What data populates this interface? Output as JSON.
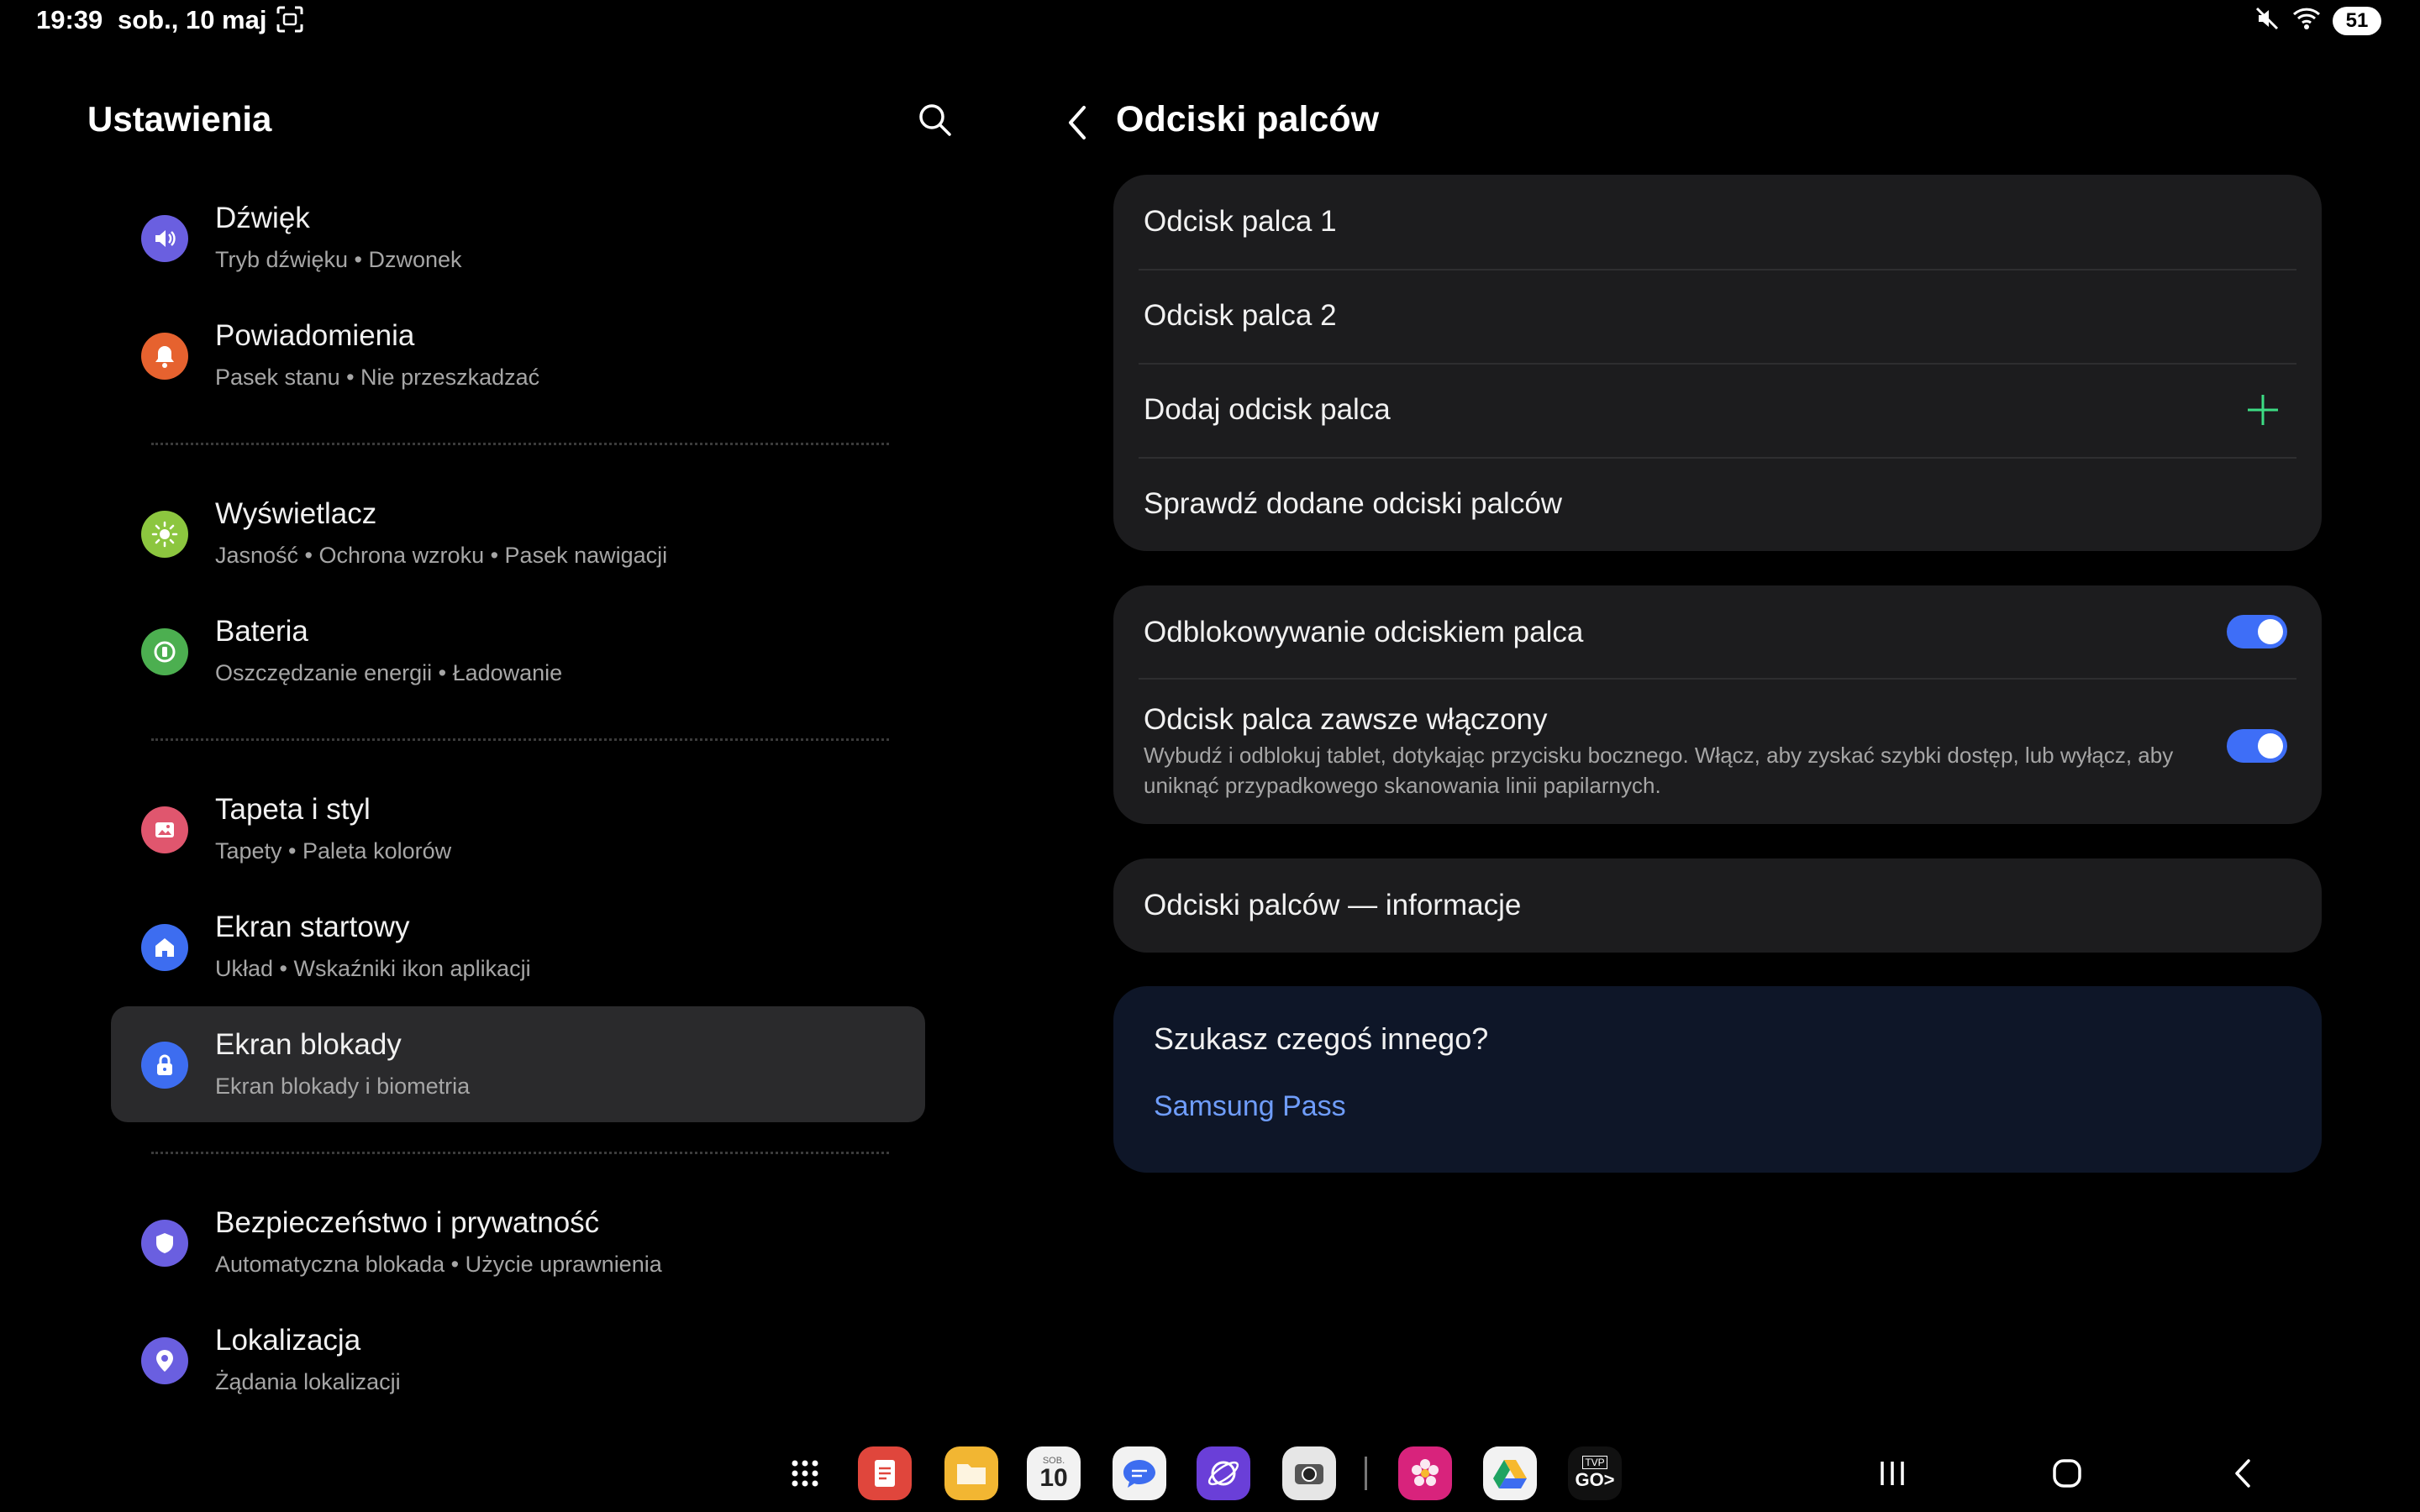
{
  "status_bar": {
    "time": "19:39",
    "date": "sob., 10 maj",
    "battery": "51",
    "icons": [
      "screenshot-icon",
      "mute-icon",
      "wifi-icon"
    ]
  },
  "left_pane": {
    "title": "Ustawienia",
    "items": [
      {
        "title": "Dźwięk",
        "subtitle": "Tryb dźwięku  •  Dzwonek",
        "icon": "speaker-icon",
        "color": "#6a5fe0"
      },
      {
        "title": "Powiadomienia",
        "subtitle": "Pasek stanu  •  Nie przeszkadzać",
        "icon": "bell-icon",
        "color": "#e6622f"
      },
      {
        "title": "Wyświetlacz",
        "subtitle": "Jasność  •  Ochrona wzroku  •  Pasek nawigacji",
        "icon": "sun-icon",
        "color": "#8cc63f"
      },
      {
        "title": "Bateria",
        "subtitle": "Oszczędzanie energii  •  Ładowanie",
        "icon": "battery-icon",
        "color": "#4caf50"
      },
      {
        "title": "Tapeta i styl",
        "subtitle": "Tapety  •  Paleta kolorów",
        "icon": "image-icon",
        "color": "#e0566e"
      },
      {
        "title": "Ekran startowy",
        "subtitle": "Układ  •  Wskaźniki ikon aplikacji",
        "icon": "home-icon",
        "color": "#3d6df0"
      },
      {
        "title": "Ekran blokady",
        "subtitle": "Ekran blokady i biometria",
        "icon": "lock-icon",
        "color": "#3d6df0"
      },
      {
        "title": "Bezpieczeństwo i prywatność",
        "subtitle": "Automatyczna blokada  •  Użycie uprawnienia",
        "icon": "shield-icon",
        "color": "#6a5fe0"
      },
      {
        "title": "Lokalizacja",
        "subtitle": "Żądania lokalizacji",
        "icon": "location-pin-icon",
        "color": "#6a5fe0"
      }
    ]
  },
  "right_pane": {
    "title": "Odciski palców",
    "fingerprints_card": {
      "rows": [
        "Odcisk palca 1",
        "Odcisk palca 2",
        "Dodaj odcisk palca",
        "Sprawdź dodane odciski palców"
      ]
    },
    "toggles_card": {
      "unlock": {
        "label": "Odblokowywanie odciskiem palca",
        "on": true
      },
      "always_on": {
        "label": "Odcisk palca zawsze włączony",
        "description_line1": "Wybudź i odblokuj tablet, dotykając przycisku bocznego. Włącz, aby zyskać szybki dostęp, lub wyłącz, aby",
        "description_line2": "uniknąć przypadkowego skanowania linii papilarnych.",
        "on": true
      }
    },
    "info_row": "Odciski palców — informacje",
    "help": {
      "question": "Szukasz czegoś innego?",
      "link": "Samsung Pass"
    }
  },
  "dock": {
    "apps": [
      "apps-grid-icon",
      "notes-app-icon",
      "files-app-icon",
      "calendar-app-icon",
      "messages-app-icon",
      "internet-app-icon",
      "camera-app-icon",
      "gallery-app-icon",
      "drive-app-icon",
      "tvp-go-app-icon"
    ],
    "calendar_day": "SOB.",
    "calendar_date": "10",
    "tvp_top": "TVP",
    "tvp_bottom": "GO>"
  },
  "colors": {
    "accent": "#3e6ef7",
    "link": "#6f9dfb",
    "plus": "#3ddc84"
  }
}
